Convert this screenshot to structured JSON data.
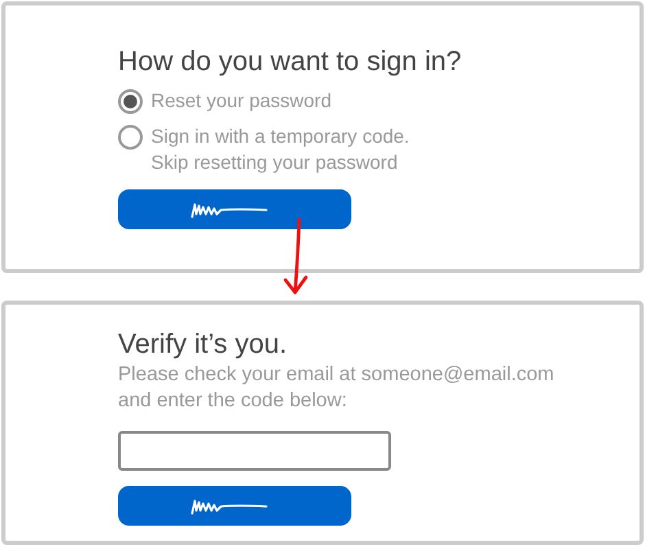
{
  "panels": [
    {
      "kind": "choice",
      "title": "How do you want to sign in?",
      "options": [
        {
          "label": "Reset your password",
          "selected": true
        },
        {
          "label": "Sign in with a temporary code.",
          "detail": "Skip resetting your password",
          "selected": false
        }
      ],
      "button": {
        "kind": "scribble"
      }
    },
    {
      "kind": "code",
      "title": "Verify it’s you.",
      "description": [
        "Please check your email at someone@email.com",
        "and enter the code below:"
      ],
      "button": {
        "kind": "scribble"
      }
    }
  ]
}
